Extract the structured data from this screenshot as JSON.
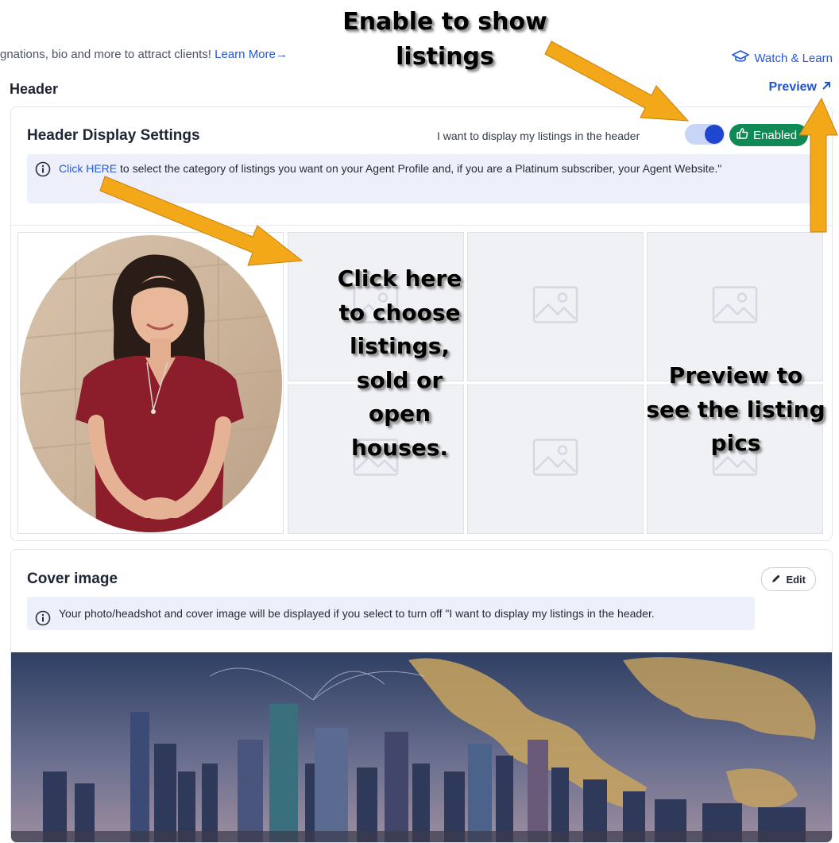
{
  "intro": {
    "text": "gnations, bio and more to attract clients! ",
    "learn_more": "Learn More→",
    "watch_learn": "Watch & Learn"
  },
  "header_section": {
    "title": "Header",
    "preview_label": "Preview",
    "display_settings": {
      "title": "Header Display Settings",
      "toggle_label": "I want to display my listings in the header",
      "toggle_on": true,
      "badge": "Enabled",
      "info_link": "Click HERE",
      "info_text": " to select the category of listings you want on your Agent Profile and, if you are a Platinum subscriber, your Agent Website.\""
    }
  },
  "cover_section": {
    "title": "Cover image",
    "edit_label": "Edit",
    "info_text": "Your photo/headshot and cover image will be displayed if you select to turn off \"I want to display my listings in the header."
  },
  "annotations": {
    "enable": "Enable to show listings",
    "click": "Click here to choose listings, sold or open houses.",
    "preview": "Preview to see the listing pics"
  },
  "colors": {
    "accent_blue": "#1e46cf",
    "link_blue": "#2458d6",
    "enabled_green": "#0f8a55",
    "info_bg": "#edf0fb",
    "arrow_orange": "#f2a818"
  }
}
